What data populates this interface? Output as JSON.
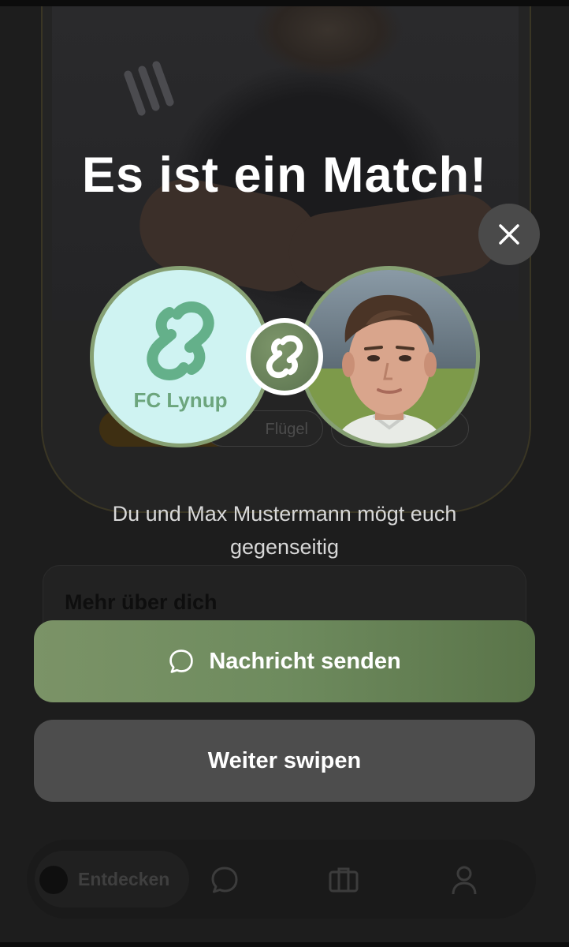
{
  "overlay": {
    "title": "Es ist ein Match!",
    "subtitle": "Du und Max Mustermann mögt euch gegenseitig",
    "close_icon": "close-icon"
  },
  "club": {
    "name": "FC Lynup",
    "logo_icon": "chain-link-icon"
  },
  "player": {
    "avatar": "player-photo"
  },
  "actions": {
    "send_message": "Nachricht senden",
    "send_message_icon": "chat-bubble-icon",
    "keep_swiping": "Weiter swipen"
  },
  "background": {
    "chips": [
      "Flügel"
    ],
    "section_title": "Mehr über dich",
    "nav": {
      "active_label": "Entdecken",
      "icons": [
        "chat-icon",
        "briefcase-icon",
        "profile-icon"
      ]
    }
  },
  "colors": {
    "accent": "#6e8b5e",
    "avatar_border": "#86a073",
    "club_text": "#6ca57d",
    "club_bg": "#cff3f2"
  }
}
